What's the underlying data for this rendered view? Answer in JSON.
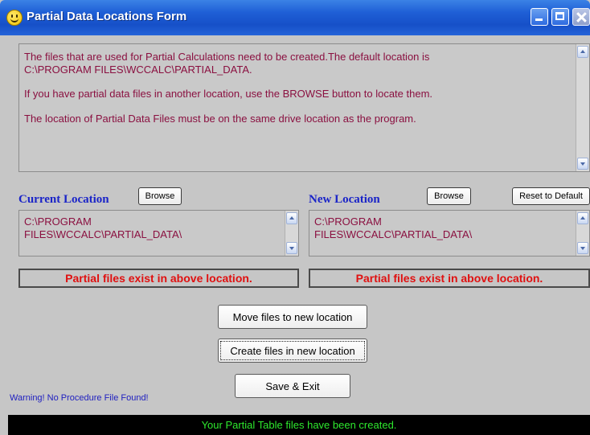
{
  "window": {
    "title": "Partial Data Locations Form",
    "icon": "smiley-icon",
    "controls": [
      "minimize-icon",
      "maximize-icon",
      "close-icon"
    ]
  },
  "info": {
    "line1": "The files that are used for Partial Calculations need to be created.The default location is",
    "line2": "C:\\PROGRAM FILES\\WCCALC\\PARTIAL_DATA.",
    "line3": "If you have partial data files in another location, use the BROWSE button to locate them.",
    "line4": "The location of Partial Data Files must be on the same drive location as the program."
  },
  "current": {
    "label": "Current Location",
    "browse_label": "Browse",
    "path_line1": "C:\\PROGRAM",
    "path_line2": "FILES\\WCCALC\\PARTIAL_DATA\\",
    "status": "Partial files exist in above location."
  },
  "new_location": {
    "label": "New Location",
    "browse_label": "Browse",
    "reset_label": "Reset to Default",
    "path_line1": "C:\\PROGRAM",
    "path_line2": "FILES\\WCCALC\\PARTIAL_DATA\\",
    "status": "Partial files exist in above location."
  },
  "actions": {
    "move_label": "Move files to new location",
    "create_label": "Create files in new location",
    "save_label": "Save & Exit"
  },
  "warning": "Warning! No Procedure File Found!",
  "status_bar": "Your Partial Table files have been created.",
  "colors": {
    "info_text": "#8a1040",
    "label_blue": "#1a24c8",
    "status_red": "#e01010",
    "status_bar_text": "#2ee82e"
  }
}
